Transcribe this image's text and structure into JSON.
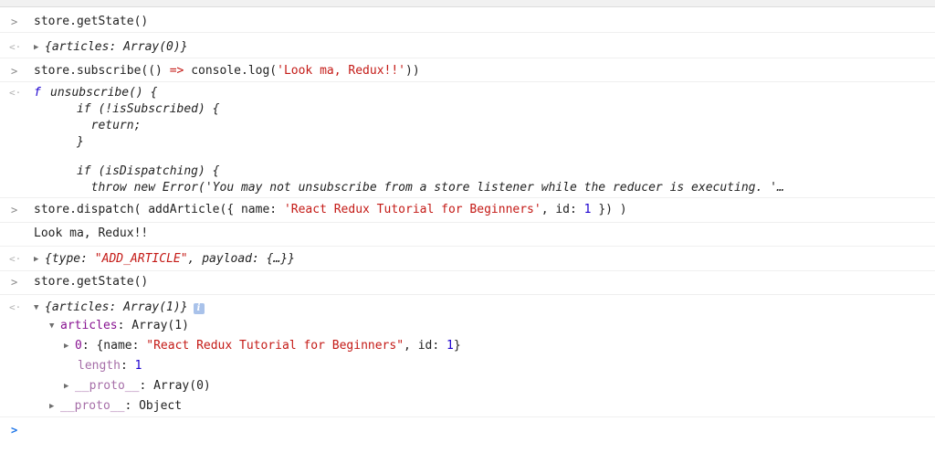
{
  "console": {
    "entry1": {
      "input": "store.getState()",
      "output": "{articles: Array(0)}"
    },
    "entry2": {
      "input_prefix": "store.subscribe(() ",
      "input_arrow": "=>",
      "input_mid": " console.log(",
      "input_string": "'Look ma, Redux!!'",
      "input_suffix": "))",
      "fn_keyword": "f",
      "fn_lines": [
        "unsubscribe() {",
        "      if (!isSubscribed) {",
        "        return;",
        "      }",
        "",
        "      if (isDispatching) {",
        "        throw new Error('You may not unsubscribe from a store listener while the reducer is executing. '…"
      ]
    },
    "entry3": {
      "input_prefix": "store.dispatch( addArticle({ name: ",
      "input_string": "'React Redux Tutorial for Beginners'",
      "input_mid": ", id: ",
      "input_number": "1",
      "input_suffix": " }) )",
      "log": "Look ma, Redux!!",
      "output_prefix": "{type: ",
      "output_string": "\"ADD_ARTICLE\"",
      "output_suffix": ", payload: {…}}"
    },
    "entry4": {
      "input": "store.getState()",
      "output": "{articles: Array(1)}",
      "info_badge": "i",
      "tree": {
        "articles_key": "articles",
        "articles_value": ": Array(1)",
        "item0_key": "0",
        "item0_prefix": ": {name: ",
        "item0_string": "\"React Redux Tutorial for Beginners\"",
        "item0_mid": ", id: ",
        "item0_number": "1",
        "item0_suffix": "}",
        "length_key": "length",
        "length_colon": ": ",
        "length_value": "1",
        "proto_inner_key": "__proto__",
        "proto_inner_value": ": Array(0)",
        "proto_outer_key": "__proto__",
        "proto_outer_value": ": Object"
      }
    },
    "prompt_symbol": ">",
    "return_symbol": "<·",
    "expand_closed": "▶",
    "expand_open": "▼"
  }
}
